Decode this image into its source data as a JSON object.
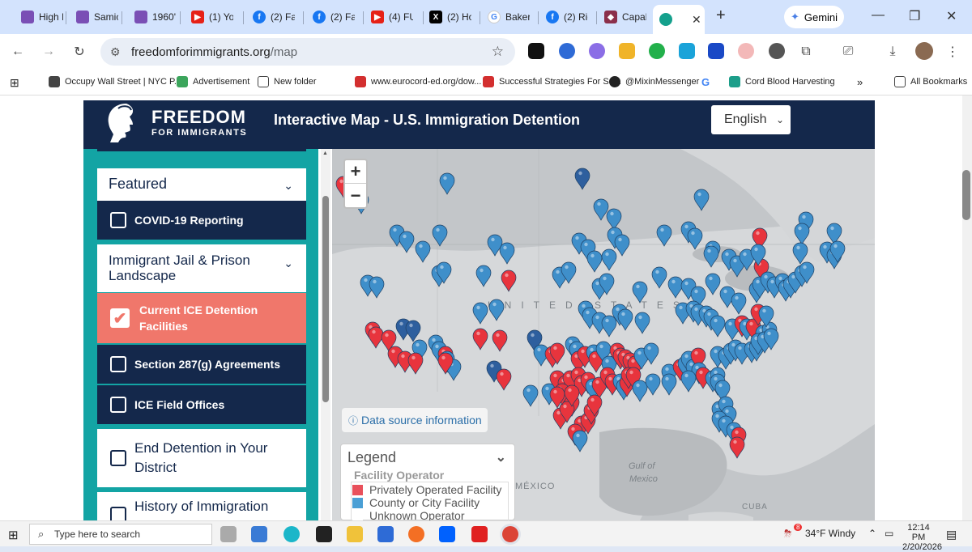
{
  "browser": {
    "tabs": [
      {
        "label": "High I"
      },
      {
        "label": "Samic"
      },
      {
        "label": "1960'"
      },
      {
        "label": "(1) Yo"
      },
      {
        "label": "(2) Fa"
      },
      {
        "label": "(2) Fa"
      },
      {
        "label": "(4) FU"
      },
      {
        "label": "(2) Ho"
      },
      {
        "label": "Baker"
      },
      {
        "label": "(2) Ric"
      },
      {
        "label": "Capal"
      }
    ],
    "gemini_label": "Gemini",
    "url_domain": "freedomforimmigrants.org",
    "url_path": "/map",
    "bookmarks": [
      {
        "label": "Occupy Wall Street | NYC P..."
      },
      {
        "label": "Advertisement"
      },
      {
        "label": "New folder"
      },
      {
        "label": "www.eurocord-ed.org/dow..."
      },
      {
        "label": "Successful Strategies For Se..."
      },
      {
        "label": "@MixinMessenger"
      },
      {
        "label": "Cord Blood Harvesting"
      }
    ],
    "all_bookmarks": "All Bookmarks",
    "more": "»"
  },
  "header": {
    "logo_line1": "FREEDOM",
    "logo_line2": "FOR IMMIGRANTS",
    "title": "Interactive Map - U.S. Immigration Detention",
    "language": "English"
  },
  "sidebar": {
    "featured": "Featured",
    "covid": "COVID-19 Reporting",
    "landscape": "Immigrant Jail & Prison Landscape",
    "current_ice": "Current ICE Detention Facilities",
    "section287": "Section 287(g) Agreements",
    "field_offices": "ICE Field Offices",
    "end_detention": "End Detention in Your District",
    "history": "History of Immigration"
  },
  "map": {
    "zoom_in": "+",
    "zoom_out": "−",
    "country_label": "UNITED STATES",
    "gulf_label_1": "Gulf of",
    "gulf_label_2": "Mexico",
    "mexico_label": "MÉXICO",
    "cuba_label": "CUBA",
    "data_source": "Data source information",
    "legend_title": "Legend",
    "legend_subtitle": "Facility Operator",
    "legend_items": [
      {
        "label": "Privately Operated Facility",
        "color": "#e8505b"
      },
      {
        "label": "County or City Facility",
        "color": "#4a9fd5"
      },
      {
        "label": "Unknown Operator",
        "color": "#ffffff"
      }
    ],
    "colors": {
      "private": "#e8343d",
      "county": "#3f8fca",
      "federal": "#2e5f9e"
    }
  },
  "taskbar": {
    "search_placeholder": "Type here to search",
    "weather": "34°F  Windy",
    "time": "12:14 PM",
    "date": "2/20/2026",
    "badge": "8"
  }
}
